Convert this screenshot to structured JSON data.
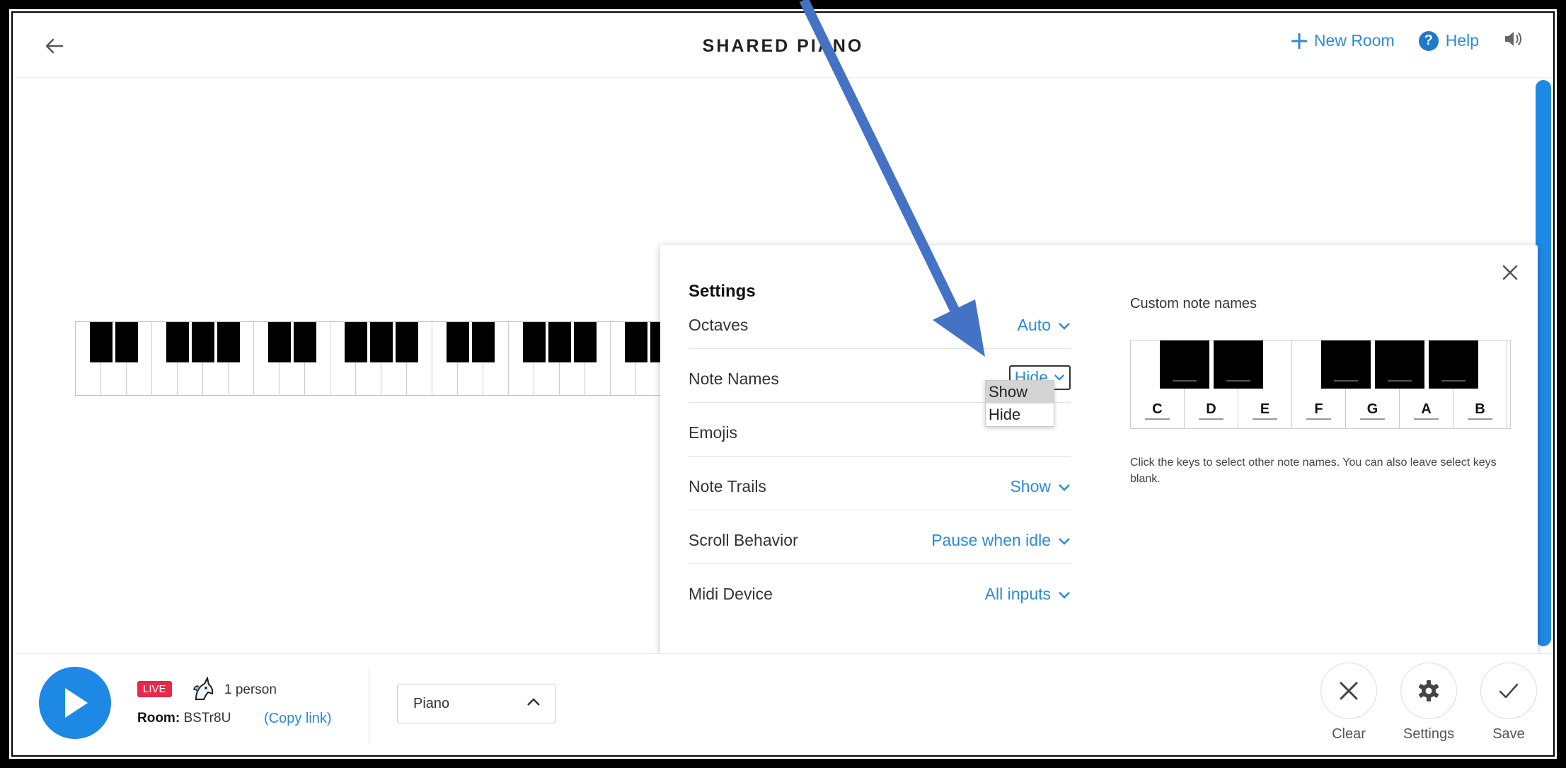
{
  "header": {
    "title": "SHARED PIANO",
    "new_room_label": "New Room",
    "help_label": "Help"
  },
  "settings": {
    "title": "Settings",
    "rows": [
      {
        "label": "Octaves",
        "value": "Auto"
      },
      {
        "label": "Note Names",
        "value": "Hide"
      },
      {
        "label": "Emojis",
        "value": ""
      },
      {
        "label": "Note Trails",
        "value": "Show"
      },
      {
        "label": "Scroll Behavior",
        "value": "Pause when idle"
      },
      {
        "label": "Midi Device",
        "value": "All inputs"
      }
    ],
    "dropdown_options": [
      "Show",
      "Hide"
    ],
    "custom_note_names_title": "Custom note names",
    "note_names": [
      "C",
      "D",
      "E",
      "F",
      "G",
      "A",
      "B"
    ],
    "hint": "Click the keys to select other note names. You can also leave select keys blank."
  },
  "bottom": {
    "live_badge": "LIVE",
    "persons": "1 person",
    "room_label": "Room:",
    "room_code": "BSTr8U",
    "copy_link": "(Copy link)",
    "instrument": "Piano",
    "clear_label": "Clear",
    "settings_label": "Settings",
    "save_label": "Save"
  },
  "colors": {
    "accent": "#1e88e5",
    "link": "#2b8ad8",
    "live": "#e8294a",
    "annotation_arrow": "#4472c4"
  }
}
